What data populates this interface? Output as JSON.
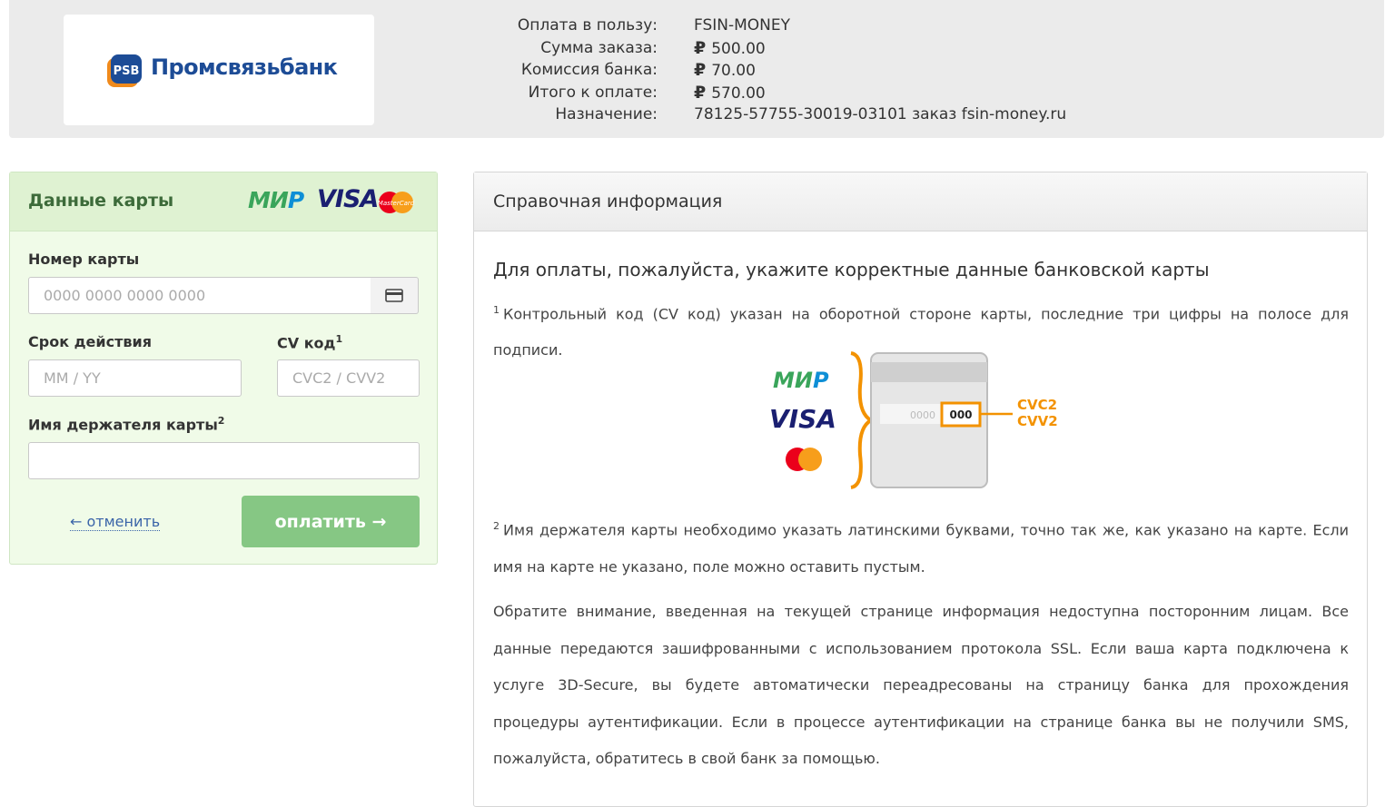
{
  "header": {
    "bank_name": "Промсвязьбанк",
    "order": [
      {
        "label": "Оплата в пользу:",
        "value": "FSIN-MONEY"
      },
      {
        "label": "Сумма заказа:",
        "currency": "₽",
        "value": "500.00"
      },
      {
        "label": "Комиссия банка:",
        "currency": "₽",
        "value": "70.00"
      },
      {
        "label": "Итого к оплате:",
        "currency": "₽",
        "value": "570.00"
      },
      {
        "label": "Назначение:",
        "value": "78125-57755-30019-03101 заказ fsin-money.ru"
      }
    ]
  },
  "card_form": {
    "title": "Данные карты",
    "brands": {
      "mir_a": "МИ",
      "mir_b": "Р",
      "visa": "VISA",
      "mastercard": "MasterCard"
    },
    "card_number": {
      "label": "Номер карты",
      "placeholder": "0000 0000 0000 0000",
      "value": ""
    },
    "expiry": {
      "label": "Срок действия",
      "placeholder": "MM / YY",
      "value": ""
    },
    "cvv": {
      "label": "CV код",
      "sup": "1",
      "placeholder": "CVC2 / CVV2",
      "value": ""
    },
    "holder": {
      "label": "Имя держателя карты",
      "sup": "2",
      "placeholder": "",
      "value": ""
    },
    "cancel_label": "← отменить",
    "pay_label": "оплатить →"
  },
  "info": {
    "title": "Справочная информация",
    "heading": "Для оплаты, пожалуйста, укажите корректные данные банковской карты",
    "note1_sup": "1",
    "note1": "Контрольный код (CV код) указан на оборотной стороне карты, последние три цифры на полосе для подписи.",
    "illustration": {
      "code": "000",
      "digits": "0000",
      "cvc2": "CVC2",
      "cvv2": "CVV2"
    },
    "note2_sup": "2",
    "note2": "Имя держателя карты необходимо указать латинскими буквами, точно так же, как указано на карте. Если имя на карте не указано, поле можно оставить пустым.",
    "note3": "Обратите внимание, введенная на текущей странице информация недоступна посторонним лицам. Все данные передаются зашифрованными с использованием протокола SSL. Если ваша карта подключена к услуге 3D-Secure, вы будете автоматически переадресованы на страницу банка для прохождения процедуры аутентификации. Если в процессе аутентификации на странице банка вы не получили SMS, пожалуйста, обратитесь в свой банк за помощью."
  },
  "colors": {
    "accent_green": "#86c784",
    "link_blue": "#3a64a8",
    "brand_blue": "#1d4c96",
    "orange": "#f39200"
  }
}
